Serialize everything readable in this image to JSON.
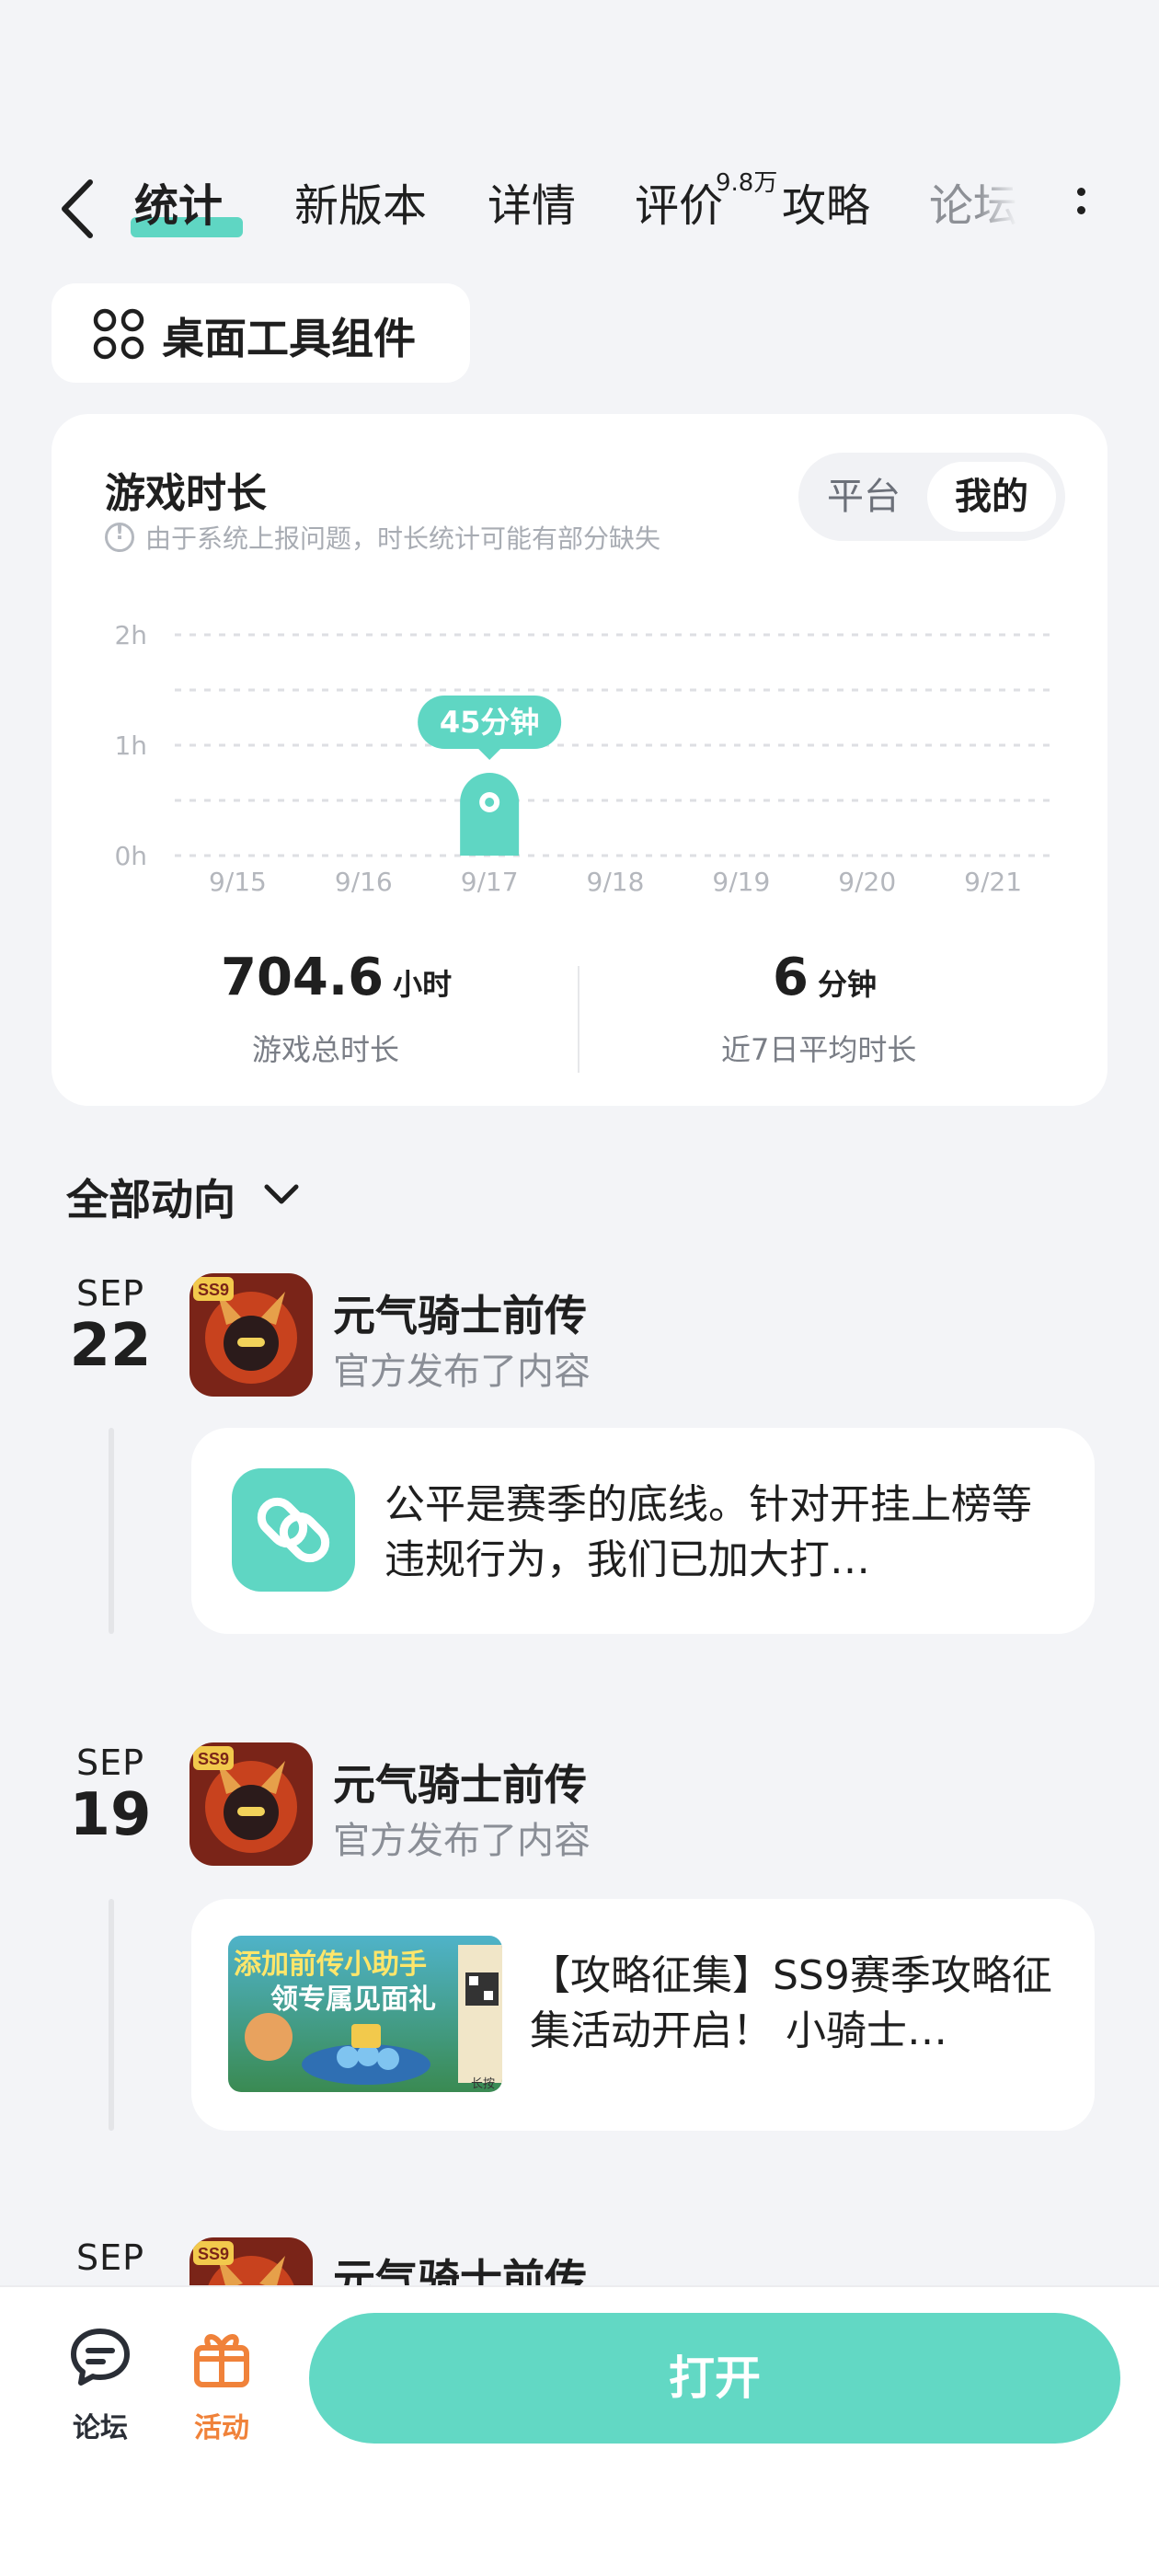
{
  "tabs": [
    {
      "label": "统计",
      "active": true
    },
    {
      "label": "新版本"
    },
    {
      "label": "详情"
    },
    {
      "label": "评价",
      "badge": "9.8万"
    },
    {
      "label": "攻略"
    },
    {
      "label": "论坛"
    }
  ],
  "widget_button": {
    "label": "桌面工具组件",
    "icon": "widgets-grid-icon"
  },
  "play_time_card": {
    "title": "游戏时长",
    "note": "由于系统上报问题，时长统计可能有部分缺失",
    "toggle": {
      "options": [
        "平台",
        "我的"
      ],
      "selected": "我的"
    },
    "total": {
      "value": "704.6",
      "unit": "小时",
      "label": "游戏总时长"
    },
    "average": {
      "value": "6",
      "unit": "分钟",
      "label": "近7日平均时长"
    }
  },
  "chart_data": {
    "type": "bar",
    "categories": [
      "9/15",
      "9/16",
      "9/17",
      "9/18",
      "9/19",
      "9/20",
      "9/21"
    ],
    "values": [
      0,
      0,
      45,
      0,
      0,
      0,
      0
    ],
    "value_unit": "minutes",
    "yticks": [
      "2h",
      "1h",
      "0h"
    ],
    "ylim": [
      0,
      120
    ],
    "highlight": {
      "category": "9/17",
      "label": "45分钟"
    },
    "grid": true,
    "color": "#5fd6c3"
  },
  "feed": {
    "section_title": "全部动向",
    "items": [
      {
        "month": "SEP",
        "day": "22",
        "app_name": "元气骑士前传",
        "action": "官方发布了内容",
        "post_text": "公平是赛季的底线。针对开挂上榜等违规行为，我们已加大打…",
        "post_icon": "link-icon"
      },
      {
        "month": "SEP",
        "day": "19",
        "app_name": "元气骑士前传",
        "action": "官方发布了内容",
        "post_text": "【攻略征集】SS9赛季攻略征集活动开启！ 小骑士…",
        "thumb_text": [
          "添加前传小助手",
          "领专属见面礼"
        ],
        "thumb_corner": "长按"
      },
      {
        "month": "SEP",
        "app_name": "元气骑士前传"
      }
    ]
  },
  "bottom_bar": {
    "forum": {
      "label": "论坛",
      "icon": "forum-chat-icon"
    },
    "activity": {
      "label": "活动",
      "icon": "gift-icon",
      "color": "#f0823a"
    },
    "open_button": "打开"
  },
  "colors": {
    "accent": "#5fd6c3",
    "background": "#f3f4f7",
    "card": "#ffffff"
  }
}
